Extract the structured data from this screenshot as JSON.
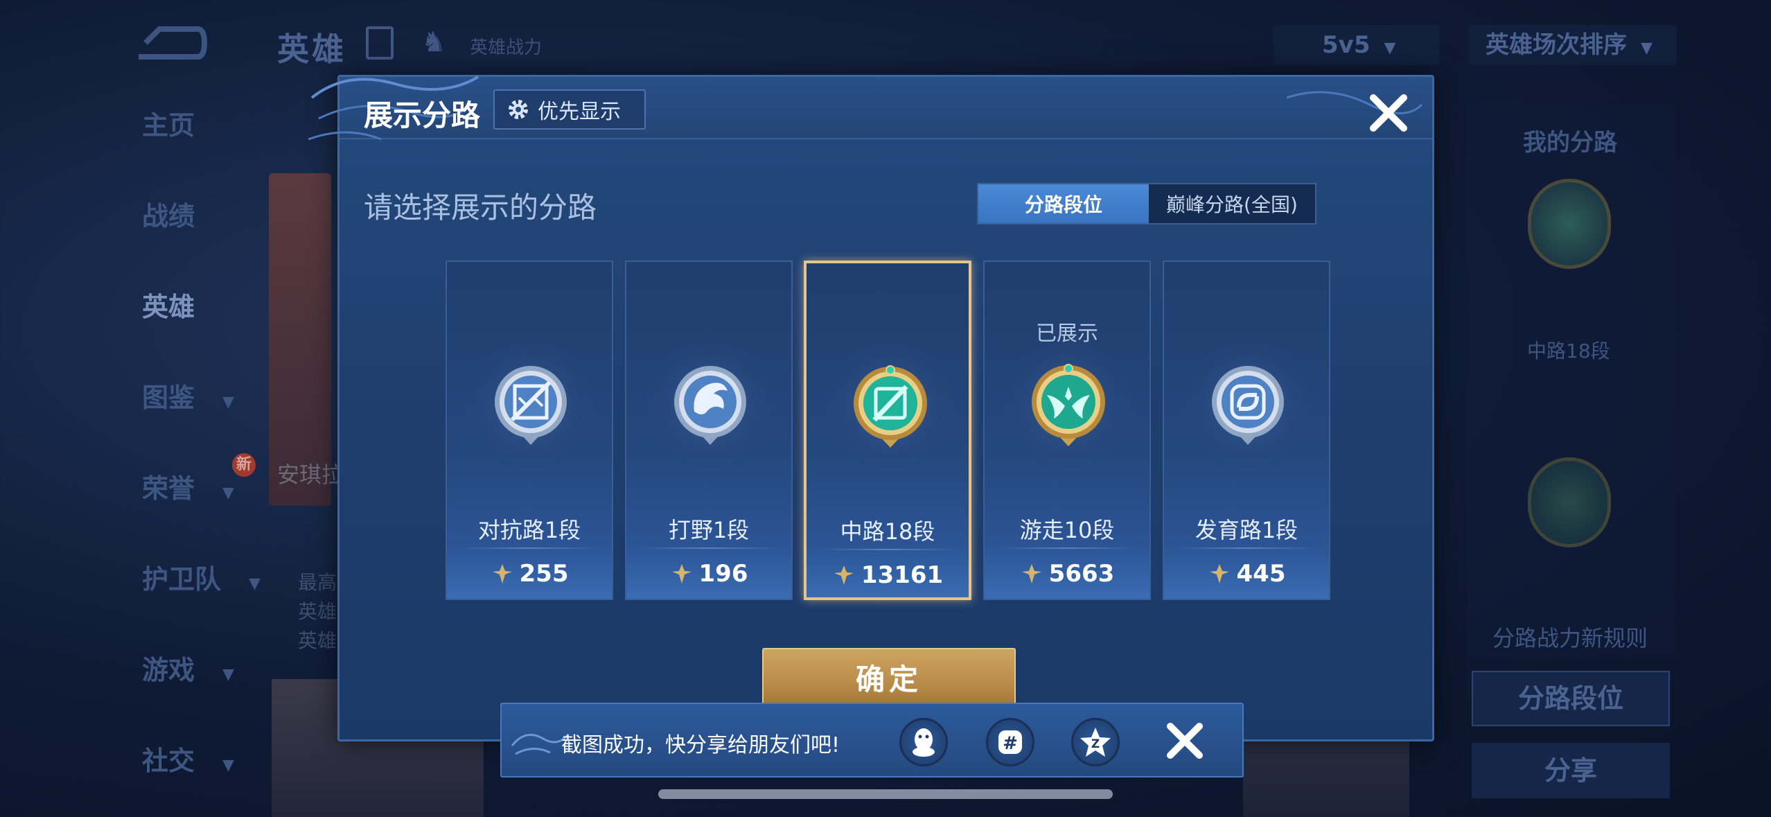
{
  "background": {
    "title": "英雄",
    "subtitle": "英雄战力",
    "mode_select": "5v5",
    "sort_select": "英雄场次排序",
    "nav": [
      {
        "label": "主页",
        "has_chevron": false
      },
      {
        "label": "战绩",
        "has_chevron": false
      },
      {
        "label": "英雄",
        "has_chevron": false,
        "active": true
      },
      {
        "label": "图鉴",
        "has_chevron": true
      },
      {
        "label": "荣誉",
        "has_chevron": true,
        "badge": "新"
      },
      {
        "label": "护卫队",
        "has_chevron": true
      },
      {
        "label": "游戏",
        "has_chevron": true
      },
      {
        "label": "社交",
        "has_chevron": true
      }
    ],
    "hero_name_partial": "安琪拉",
    "left_lines": [
      "最高",
      "英雄",
      "英雄"
    ],
    "right_panel": {
      "title": "我的分路",
      "rank": "中路18段",
      "rules": "分路战力新规则",
      "button_primary": "分路段位",
      "button_secondary": "分享"
    }
  },
  "modal": {
    "title": "展示分路",
    "priority_button": "优先显示",
    "instruction": "请选择展示的分路",
    "tabs": [
      {
        "label": "分路段位",
        "active": true
      },
      {
        "label": "巅峰分路(全国)",
        "active": false
      }
    ],
    "lanes": [
      {
        "rank": "对抗路1段",
        "power": "255",
        "badge": "clash-lane-badge-icon",
        "tier": "silver",
        "selected": false,
        "shown": false
      },
      {
        "rank": "打野1段",
        "power": "196",
        "badge": "jungle-badge-icon",
        "tier": "silver",
        "selected": false,
        "shown": false
      },
      {
        "rank": "中路18段",
        "power": "13161",
        "badge": "mid-lane-badge-icon",
        "tier": "gold",
        "selected": true,
        "shown": false
      },
      {
        "rank": "游走10段",
        "power": "5663",
        "badge": "roam-badge-icon",
        "tier": "gold",
        "selected": false,
        "shown": true,
        "shown_label": "已展示"
      },
      {
        "rank": "发育路1段",
        "power": "445",
        "badge": "farm-lane-badge-icon",
        "tier": "silver",
        "selected": false,
        "shown": false
      }
    ],
    "confirm": "确定"
  },
  "share_bar": {
    "message": "截图成功，快分享给朋友们吧!",
    "icons": [
      "qq-icon",
      "wechat-moments-icon",
      "qzone-icon"
    ]
  },
  "colors": {
    "gold_border": "#e6c58c",
    "active_tab": "#3a74c0",
    "confirm_gold": "#b88a48"
  }
}
